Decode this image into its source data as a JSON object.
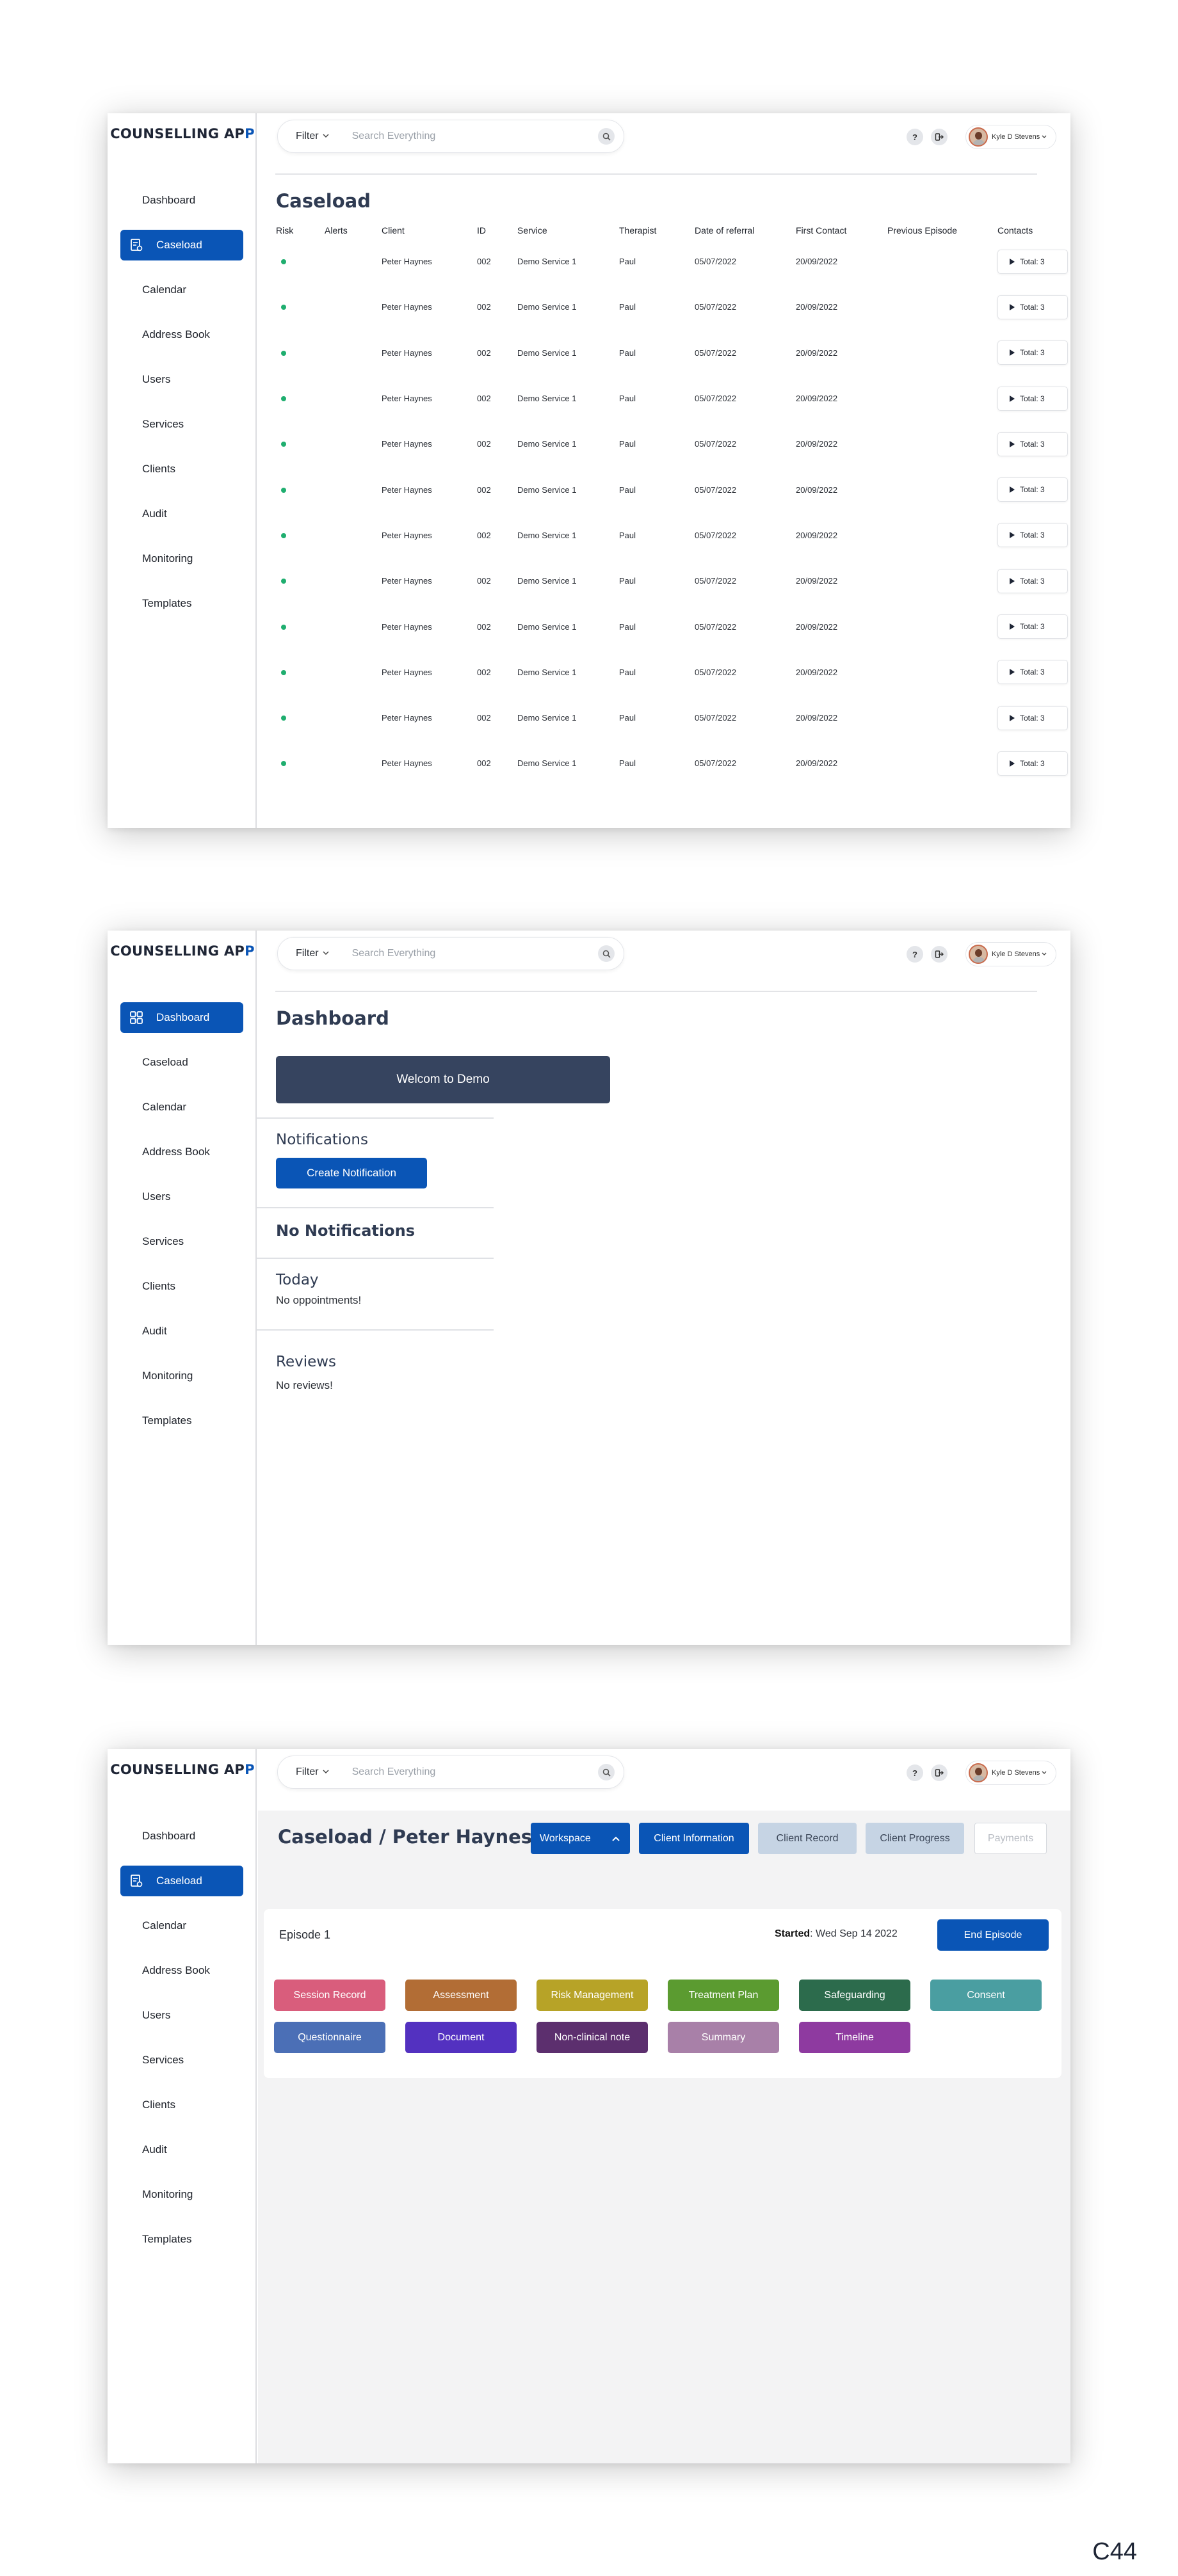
{
  "app_title": {
    "main": "COUNSELLING AP",
    "accent": "P"
  },
  "nav_items": [
    "Dashboard",
    "Caseload",
    "Calendar",
    "Address Book",
    "Users",
    "Services",
    "Clients",
    "Audit",
    "Monitoring",
    "Templates"
  ],
  "topbar": {
    "filter_label": "Filter",
    "search_placeholder": "Search Everything",
    "help_icon": "?",
    "user_name": "Kyle D Stevens"
  },
  "screen1": {
    "title": "Caseload",
    "columns": [
      "Risk",
      "Alerts",
      "Client",
      "ID",
      "Service",
      "Therapist",
      "Date of referral",
      "First Contact",
      "Previous Episode",
      "Contacts"
    ],
    "rows": [
      {
        "alerts": "",
        "client": "Peter Haynes",
        "id": "002",
        "service": "Demo Service 1",
        "therapist": "Paul",
        "referral": "05/07/2022",
        "first_contact": "20/09/2022",
        "previous": "",
        "contacts": "Total: 3"
      },
      {
        "alerts": "",
        "client": "Peter Haynes",
        "id": "002",
        "service": "Demo Service 1",
        "therapist": "Paul",
        "referral": "05/07/2022",
        "first_contact": "20/09/2022",
        "previous": "",
        "contacts": "Total: 3"
      },
      {
        "alerts": "",
        "client": "Peter Haynes",
        "id": "002",
        "service": "Demo Service 1",
        "therapist": "Paul",
        "referral": "05/07/2022",
        "first_contact": "20/09/2022",
        "previous": "",
        "contacts": "Total: 3"
      },
      {
        "alerts": "",
        "client": "Peter Haynes",
        "id": "002",
        "service": "Demo Service 1",
        "therapist": "Paul",
        "referral": "05/07/2022",
        "first_contact": "20/09/2022",
        "previous": "",
        "contacts": "Total: 3"
      },
      {
        "alerts": "",
        "client": "Peter Haynes",
        "id": "002",
        "service": "Demo Service 1",
        "therapist": "Paul",
        "referral": "05/07/2022",
        "first_contact": "20/09/2022",
        "previous": "",
        "contacts": "Total: 3"
      },
      {
        "alerts": "",
        "client": "Peter Haynes",
        "id": "002",
        "service": "Demo Service 1",
        "therapist": "Paul",
        "referral": "05/07/2022",
        "first_contact": "20/09/2022",
        "previous": "",
        "contacts": "Total: 3"
      },
      {
        "alerts": "",
        "client": "Peter Haynes",
        "id": "002",
        "service": "Demo Service 1",
        "therapist": "Paul",
        "referral": "05/07/2022",
        "first_contact": "20/09/2022",
        "previous": "",
        "contacts": "Total: 3"
      },
      {
        "alerts": "",
        "client": "Peter Haynes",
        "id": "002",
        "service": "Demo Service 1",
        "therapist": "Paul",
        "referral": "05/07/2022",
        "first_contact": "20/09/2022",
        "previous": "",
        "contacts": "Total: 3"
      },
      {
        "alerts": "",
        "client": "Peter Haynes",
        "id": "002",
        "service": "Demo Service 1",
        "therapist": "Paul",
        "referral": "05/07/2022",
        "first_contact": "20/09/2022",
        "previous": "",
        "contacts": "Total: 3"
      },
      {
        "alerts": "",
        "client": "Peter Haynes",
        "id": "002",
        "service": "Demo Service 1",
        "therapist": "Paul",
        "referral": "05/07/2022",
        "first_contact": "20/09/2022",
        "previous": "",
        "contacts": "Total: 3"
      },
      {
        "alerts": "",
        "client": "Peter Haynes",
        "id": "002",
        "service": "Demo Service 1",
        "therapist": "Paul",
        "referral": "05/07/2022",
        "first_contact": "20/09/2022",
        "previous": "",
        "contacts": "Total: 3"
      },
      {
        "alerts": "",
        "client": "Peter Haynes",
        "id": "002",
        "service": "Demo Service 1",
        "therapist": "Paul",
        "referral": "05/07/2022",
        "first_contact": "20/09/2022",
        "previous": "",
        "contacts": "Total: 3"
      }
    ]
  },
  "screen2": {
    "title": "Dashboard",
    "welcome": "Welcom to Demo",
    "notifications_heading": "Notifications",
    "create_notification": "Create Notification",
    "no_notifications": "No Notifications",
    "today_heading": "Today",
    "today_text": "No oppointments!",
    "reviews_heading": "Reviews",
    "reviews_text": "No reviews!"
  },
  "screen3": {
    "breadcrumb": "Caseload / Peter Haynes",
    "tabs": {
      "workspace": "Workspace",
      "client_information": "Client Information",
      "client_record": "Client Record",
      "client_progress": "Client Progress",
      "payments": "Payments"
    },
    "episode": "Episode 1",
    "started_label": "Started",
    "started_value": ": Wed Sep 14 2022",
    "end_episode": "End Episode",
    "record_buttons": [
      {
        "label": "Session Record",
        "color": "#d95d7c"
      },
      {
        "label": "Assessment",
        "color": "#b26d35"
      },
      {
        "label": "Risk Management",
        "color": "#b7a327"
      },
      {
        "label": "Treatment Plan",
        "color": "#5b9b30"
      },
      {
        "label": "Safeguarding",
        "color": "#2c6b4c"
      },
      {
        "label": "Consent",
        "color": "#4a9ea1"
      },
      {
        "label": "Questionnaire",
        "color": "#4b6fb6"
      },
      {
        "label": "Document",
        "color": "#5331c0"
      },
      {
        "label": "Non-clinical note",
        "color": "#5c2f6e"
      },
      {
        "label": "Summary",
        "color": "#a880a8"
      },
      {
        "label": "Timeline",
        "color": "#8e3aa0"
      }
    ]
  },
  "page_label": "C44",
  "colors": {
    "primary": "#0a55b6",
    "dark_banner": "#36445f",
    "risk_green": "#1fae6f",
    "client_link": "#6a4fe0",
    "muted_tab": "#c6d4e4"
  }
}
